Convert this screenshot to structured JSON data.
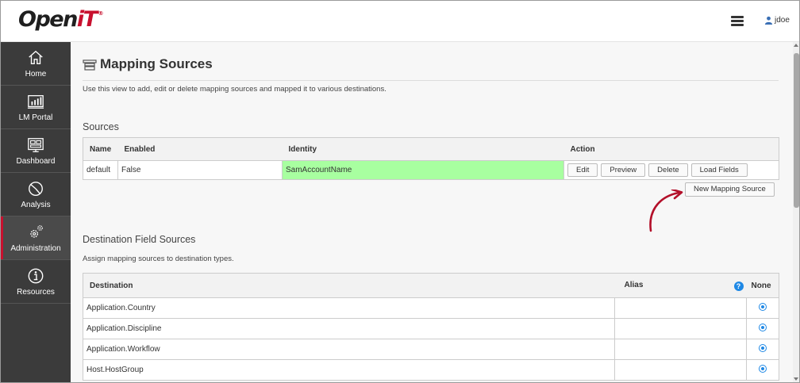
{
  "app": {
    "logo_main": "Open",
    "logo_accent": "iT",
    "logo_mark": "®"
  },
  "header": {
    "user_name": "jdoe"
  },
  "sidebar": {
    "items": [
      {
        "label": "Home",
        "icon": "home-icon"
      },
      {
        "label": "LM Portal",
        "icon": "bar-chart-icon"
      },
      {
        "label": "Dashboard",
        "icon": "dashboard-icon"
      },
      {
        "label": "Analysis",
        "icon": "pie-chart-icon"
      },
      {
        "label": "Administration",
        "icon": "gears-icon",
        "active": true
      },
      {
        "label": "Resources",
        "icon": "info-icon"
      }
    ]
  },
  "page": {
    "title": "Mapping Sources",
    "description": "Use this view to add, edit or delete mapping sources and mapped it to various destinations."
  },
  "sources": {
    "heading": "Sources",
    "columns": [
      "Name",
      "Enabled",
      "Identity",
      "Action"
    ],
    "rows": [
      {
        "name": "default",
        "enabled": "False",
        "identity": "SamAccountName"
      }
    ],
    "actions": [
      "Edit",
      "Preview",
      "Delete",
      "Load Fields"
    ],
    "new_button": "New Mapping Source"
  },
  "destinations": {
    "heading": "Destination Field Sources",
    "description": "Assign mapping sources to destination types.",
    "columns": [
      "Destination",
      "Alias",
      "None"
    ],
    "help_glyph": "?",
    "rows": [
      {
        "destination": "Application.Country",
        "alias": "",
        "none_selected": true
      },
      {
        "destination": "Application.Discipline",
        "alias": "",
        "none_selected": true
      },
      {
        "destination": "Application.Workflow",
        "alias": "",
        "none_selected": true
      },
      {
        "destination": "Host.HostGroup",
        "alias": "",
        "none_selected": true
      }
    ]
  },
  "colors": {
    "accent": "#c8102e",
    "highlight": "#a8ffa0",
    "link": "#1e88e5",
    "sidebar": "#3b3b3b"
  }
}
